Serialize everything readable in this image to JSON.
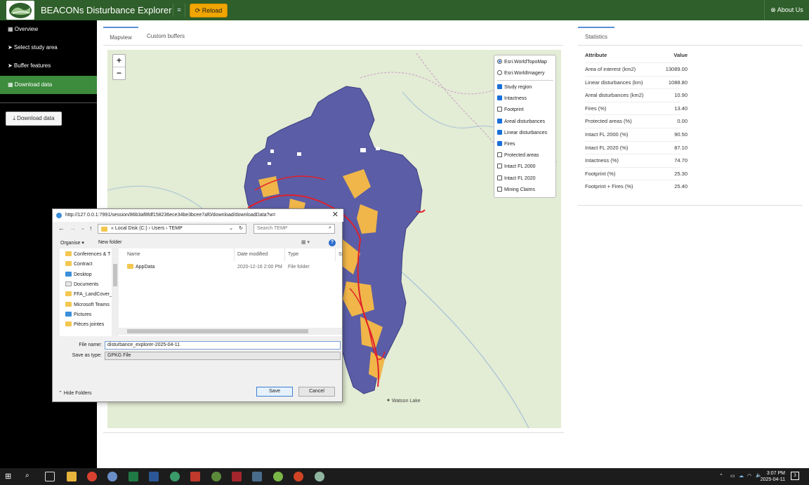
{
  "navbar": {
    "brand": "BEACONs Disturbance Explorer",
    "menu_icon": "hamburger-icon",
    "reload_label": "⟳ Reload",
    "about_label": "⊗ About Us"
  },
  "sidebar": {
    "items": [
      {
        "label": "▦ Overview",
        "active": false
      },
      {
        "label": "➤ Select study area",
        "active": false
      },
      {
        "label": "➤ Buffer features",
        "active": false
      },
      {
        "label": "▦ Download data",
        "active": true
      }
    ],
    "download_button": "⤓ Download data"
  },
  "tabs": {
    "mapview": "Mapview",
    "custom_buffers": "Custom buffers"
  },
  "map": {
    "zoom_in": "+",
    "zoom_out": "−",
    "basemaps": [
      {
        "label": "Esri.WorldTopoMap",
        "selected": true
      },
      {
        "label": "Esri.WorldImagery",
        "selected": false
      }
    ],
    "layers": [
      {
        "label": "Study region",
        "checked": true
      },
      {
        "label": "Intactness",
        "checked": true
      },
      {
        "label": "Footprint",
        "checked": false
      },
      {
        "label": "Areal disturbances",
        "checked": true
      },
      {
        "label": "Linear disturbances",
        "checked": true
      },
      {
        "label": "Fires",
        "checked": true
      },
      {
        "label": "Protected areas",
        "checked": false
      },
      {
        "label": "Intact FL 2000",
        "checked": false
      },
      {
        "label": "Intact FL 2020",
        "checked": false
      },
      {
        "label": "Mining Claims",
        "checked": false
      }
    ],
    "place_labels": {
      "watson_lake": "Watson Lake"
    },
    "colors": {
      "study_region": "#5b5ea6",
      "areal": "#f0b64a",
      "linear": "#e0202a",
      "base": "#e3ecd4"
    }
  },
  "statistics": {
    "tab": "Statistics",
    "headers": [
      "Attribute",
      "Value"
    ],
    "rows": [
      {
        "attr": "Area of interest (km2)",
        "value": "13089.00"
      },
      {
        "attr": "Linear disturbances (km)",
        "value": "1088.80"
      },
      {
        "attr": "Areal disturbances (km2)",
        "value": "10.90"
      },
      {
        "attr": "Fires (%)",
        "value": "13.40"
      },
      {
        "attr": "Protected areas (%)",
        "value": "0.00"
      },
      {
        "attr": "Intact FL 2000 (%)",
        "value": "90.50"
      },
      {
        "attr": "Intact FL 2020 (%)",
        "value": "87.10"
      },
      {
        "attr": "Intactness (%)",
        "value": "74.70"
      },
      {
        "attr": "Footprint (%)",
        "value": "25.30"
      },
      {
        "attr": "Footprint + Fires (%)",
        "value": "25.40"
      }
    ]
  },
  "dialog": {
    "title": "http://127.0.0.1:7991/session/86b3af8fdf158236ece34be3bcee7af0/download/downloadData?w=",
    "path": "« Local Disk (C:) › Users › TEMP",
    "search_placeholder": "Search TEMP",
    "organise": "Organise ▾",
    "new_folder": "New folder",
    "tree": [
      "Conferences & T",
      "Contract",
      "Desktop",
      "Documents",
      "FFA_LandCover_",
      "Microsoft Teams",
      "Pictures",
      "Pièces jointes"
    ],
    "columns": {
      "name": "Name",
      "date": "Date modified",
      "type": "Type",
      "size": "Si"
    },
    "files": [
      {
        "name": "AppData",
        "date": "2020-12-16 2:00 PM",
        "type": "File folder"
      }
    ],
    "file_name_label": "File name:",
    "file_name_value": "disturbance_explorer-2025-04-11",
    "save_type_label": "Save as type:",
    "save_type_value": "GPKG File",
    "hide_folders": "⌃ Hide Folders",
    "save": "Save",
    "cancel": "Cancel"
  },
  "taskbar": {
    "time": "3:07 PM",
    "date": "2025-04-11",
    "notifications": "3"
  }
}
